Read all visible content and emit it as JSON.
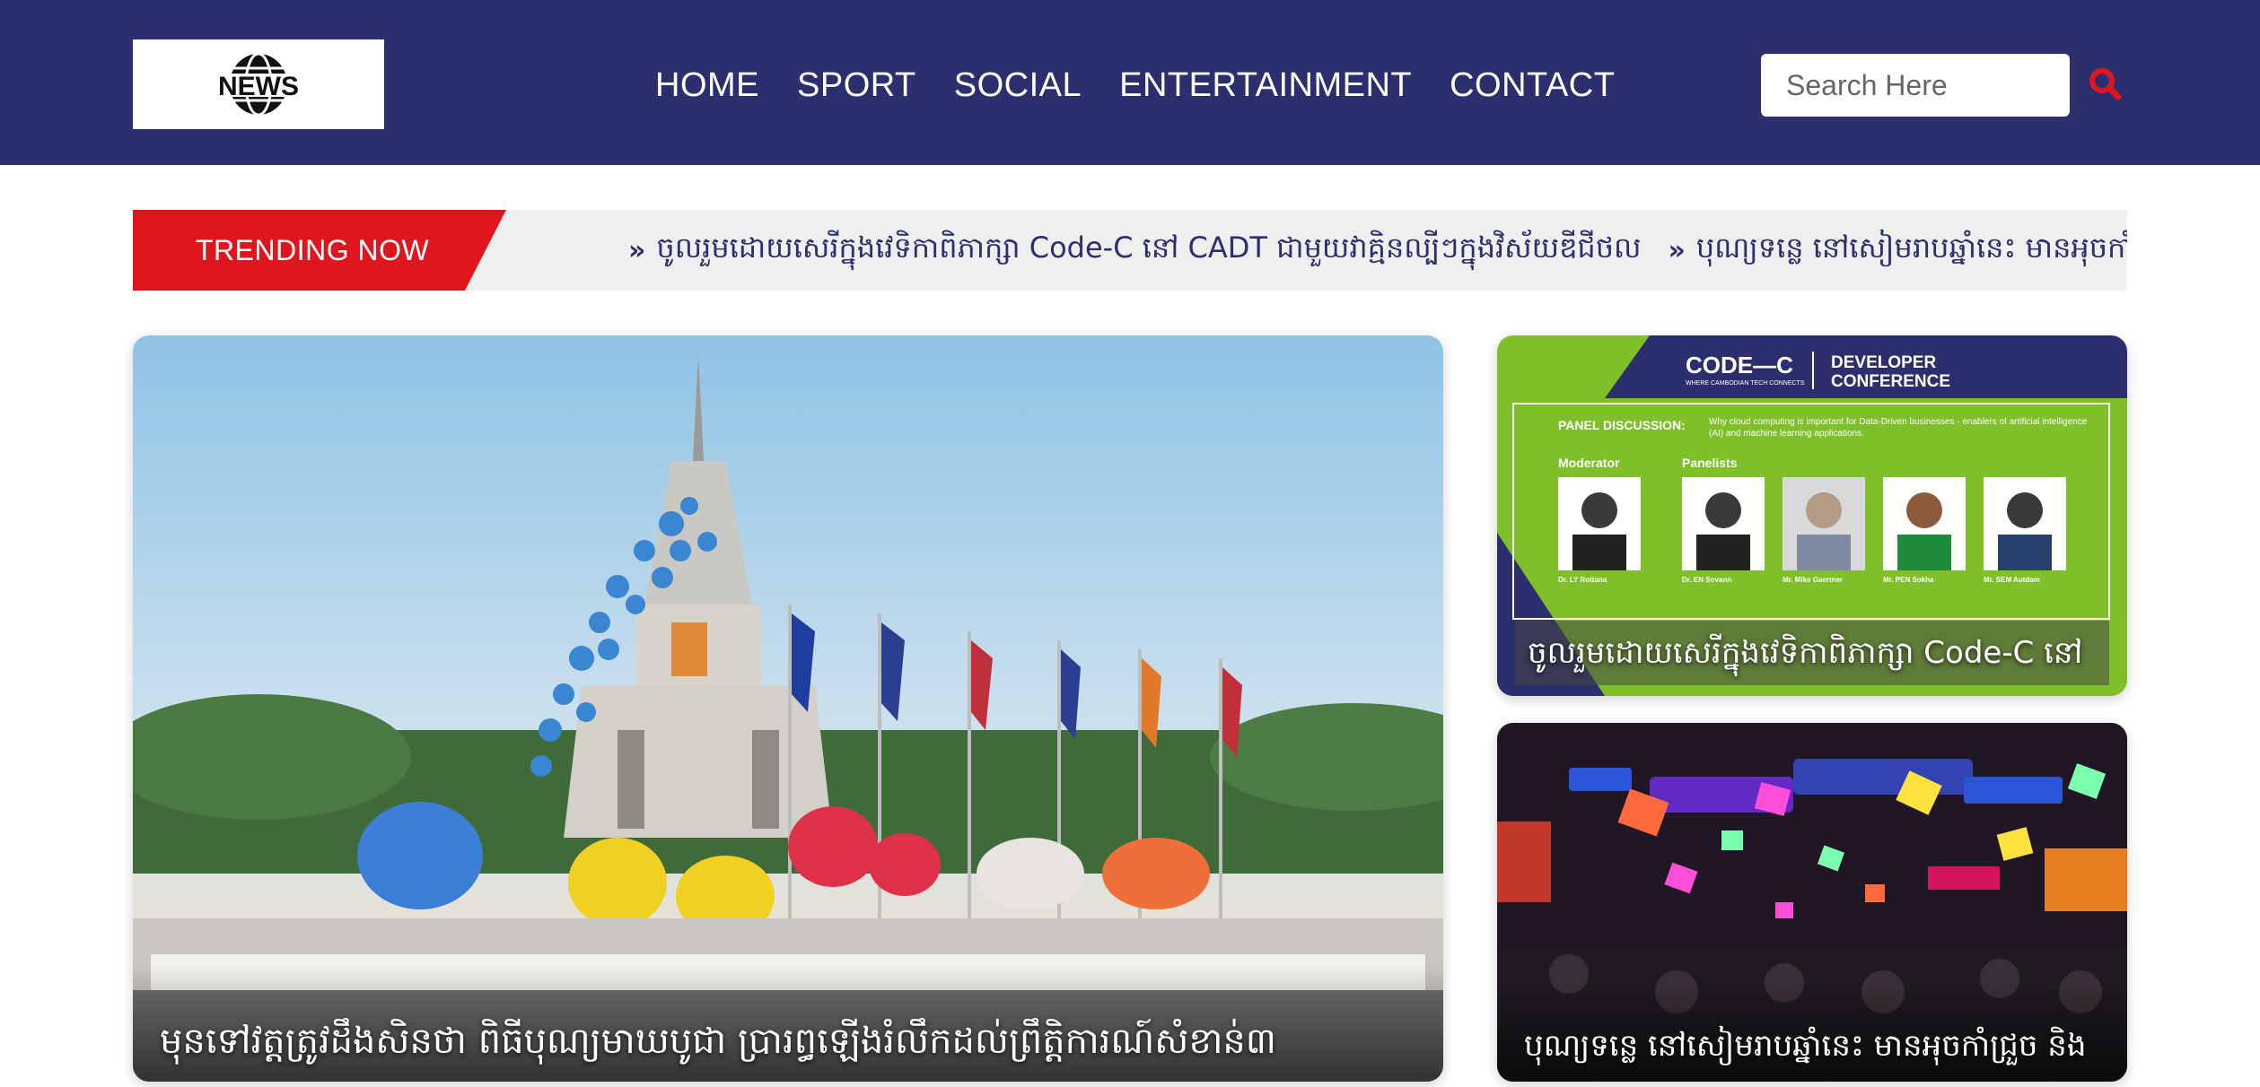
{
  "header": {
    "logo_text": "NEWS",
    "nav": [
      "HOME",
      "SPORT",
      "SOCIAL",
      "ENTERTAINMENT",
      "CONTACT"
    ],
    "search_placeholder": "Search Here",
    "search_icon": "search-icon"
  },
  "trending": {
    "label": "TRENDING NOW",
    "items": [
      "ចូលរួមដោយសេរីក្នុងវេទិកាពិភាក្សា Code-C នៅ CADT ជាមួយវាគ្មិនល្បីៗក្នុងវិស័យឌីជីថល",
      "បុណ្យទន្លេ នៅសៀមរាបឆ្នាំនេះ មានអុចកាំជ្រួច និង"
    ]
  },
  "articles": {
    "main": {
      "title": "មុនទៅវត្តត្រូវដឹងសិនថា ពិធីបុណ្យមាឃបូជា ប្រារព្ធឡើងរំលឹកដល់ព្រឹត្តិការណ៍សំខាន់៣"
    },
    "side": [
      {
        "title": "ចូលរួមដោយសេរីក្នុងវេទិកាពិភាក្សា Code-C នៅ",
        "poster": {
          "brand": "CODE—C",
          "tagline": "WHERE CAMBODIAN TECH CONNECTS",
          "event_line1": "DEVELOPER",
          "event_line2": "CONFERENCE",
          "panel_label": "PANEL DISCUSSION:",
          "panel_topic": "Why cloud computing is important for Data-Driven businesses - enablers of artificial intelligence (AI) and machine learning applications.",
          "moderator_label": "Moderator",
          "panelists_label": "Panelists",
          "people": [
            "Dr. LY Rottana",
            "Dr. EN Sovann",
            "Mr. Mike Gaertner",
            "Mr. PEN Sokha",
            "Mr. SEM Autdam"
          ]
        }
      },
      {
        "title": "បុណ្យទន្លេ នៅសៀមរាបឆ្នាំនេះ មានអុចកាំជ្រួច និង"
      }
    ]
  },
  "colors": {
    "header_bg": "#2b2f6e",
    "accent_red": "#e0161e",
    "trending_bg": "#efefef",
    "poster_green": "#7fbf2a"
  }
}
